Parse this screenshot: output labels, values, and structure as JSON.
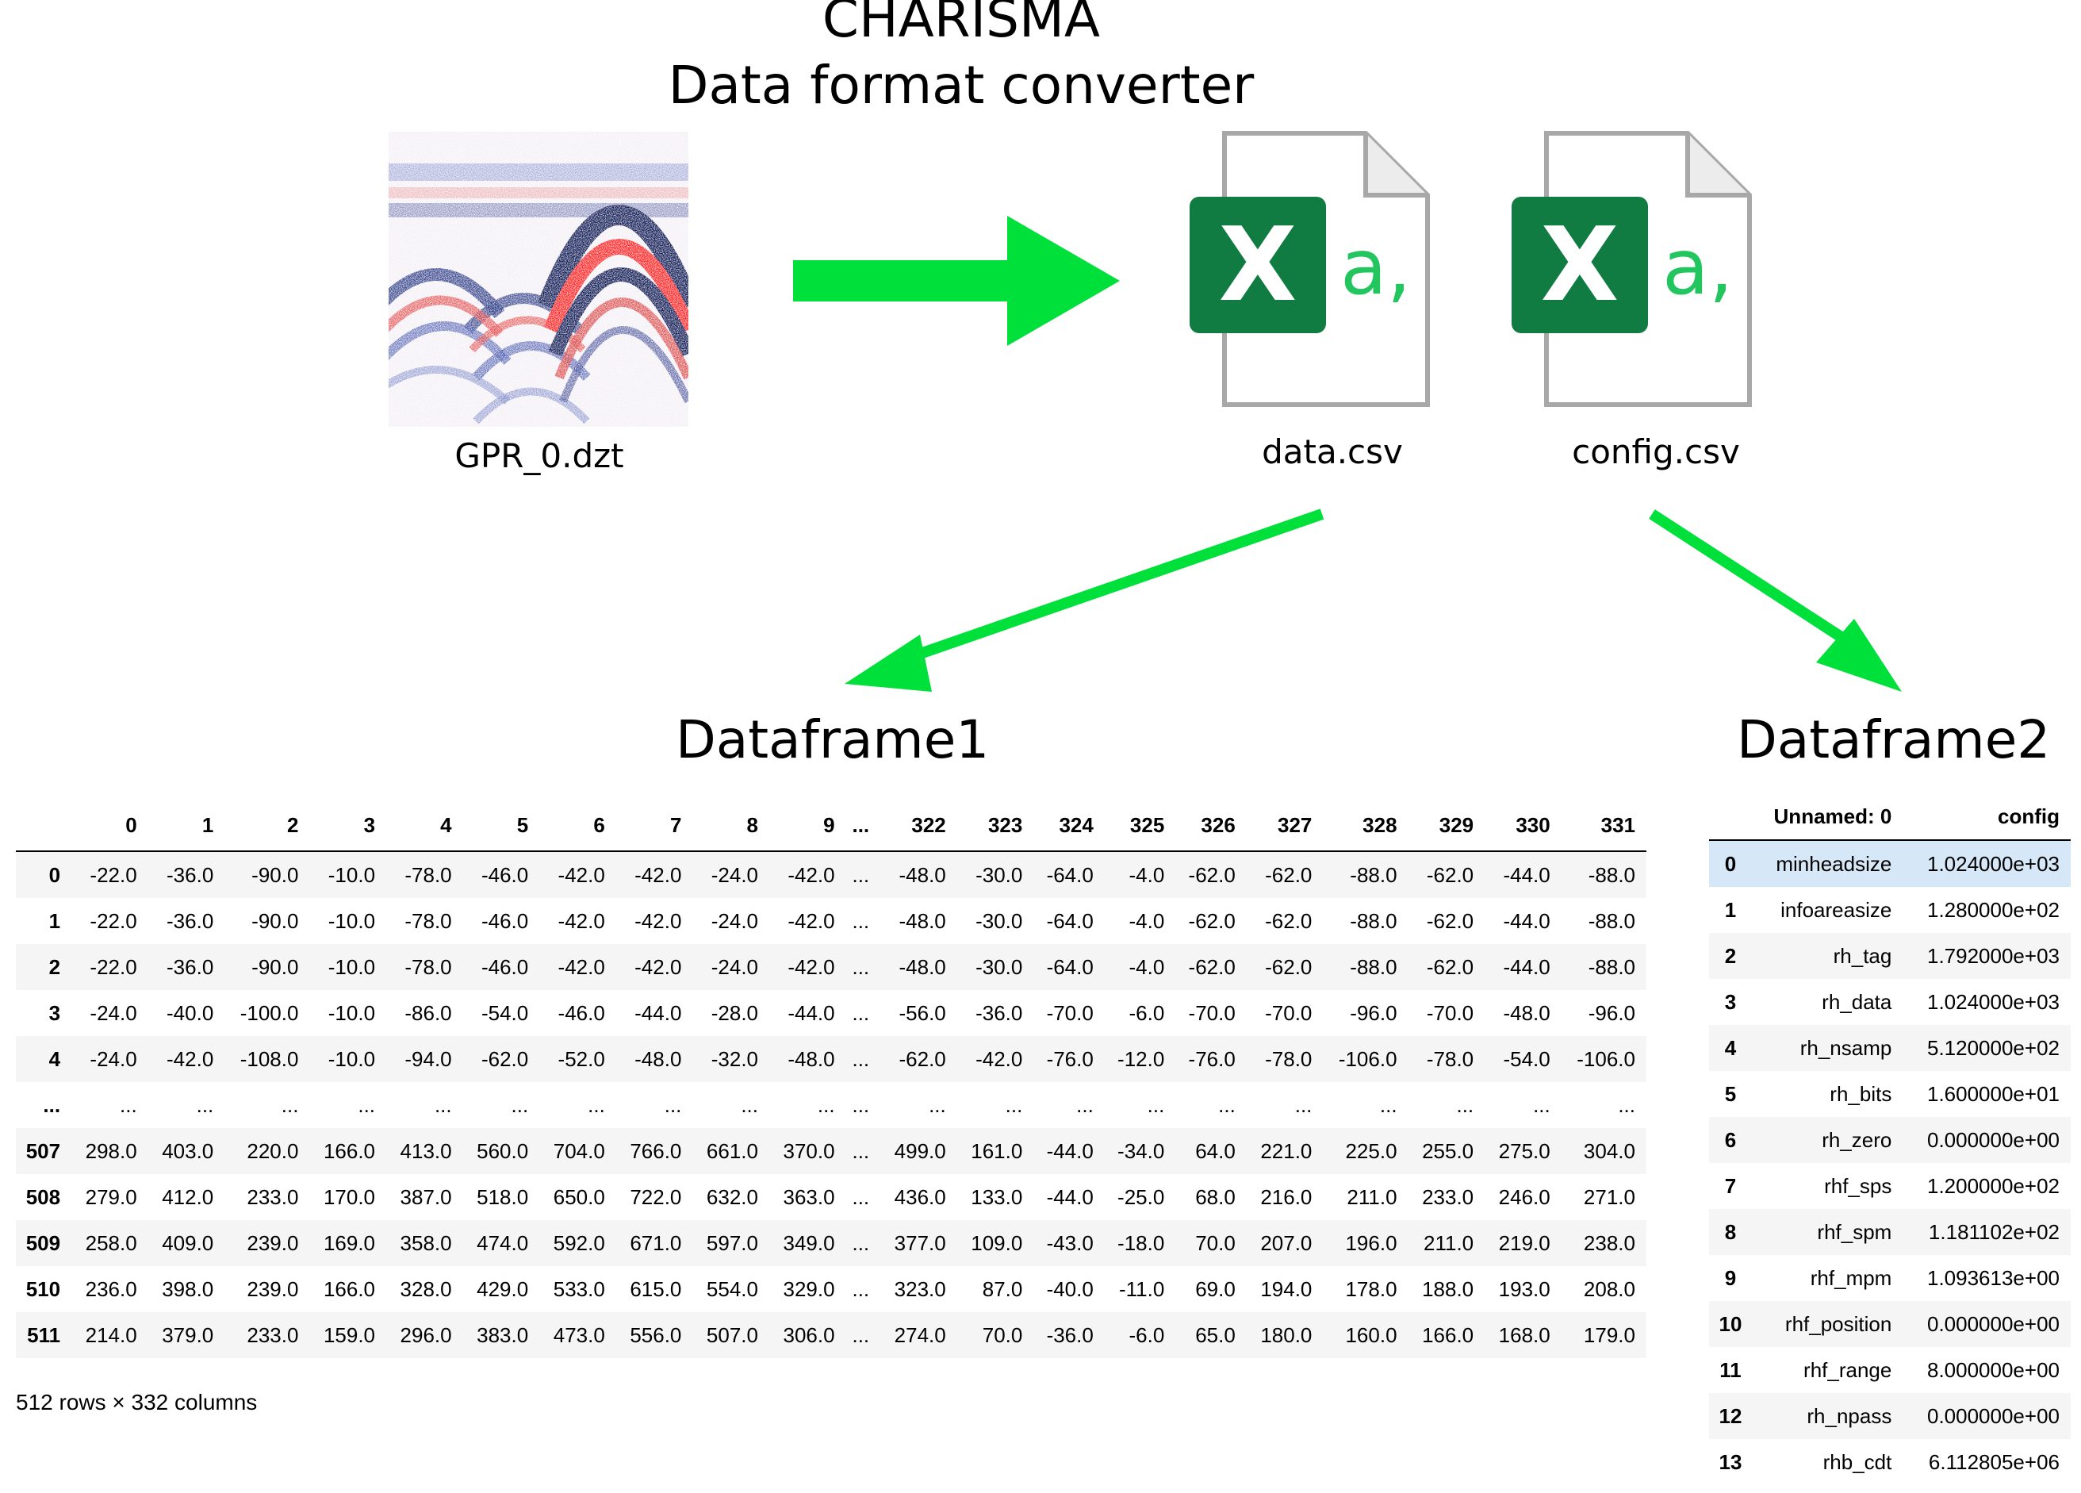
{
  "title": {
    "line1": "CHARISMA",
    "line2": "Data format converter"
  },
  "files": {
    "gpr": "GPR_0.dzt",
    "data": "data.csv",
    "config": "config.csv"
  },
  "icon_text": {
    "x": "X",
    "a": "a,"
  },
  "colors": {
    "arrow": "#00e03a",
    "excel_green": "#107c41",
    "light_green": "#22c55e"
  },
  "dataframe1": {
    "title": "Dataframe1",
    "columns": [
      "",
      "0",
      "1",
      "2",
      "3",
      "4",
      "5",
      "6",
      "7",
      "8",
      "9",
      "...",
      "322",
      "323",
      "324",
      "325",
      "326",
      "327",
      "328",
      "329",
      "330",
      "331"
    ],
    "rows": [
      [
        "0",
        "-22.0",
        "-36.0",
        "-90.0",
        "-10.0",
        "-78.0",
        "-46.0",
        "-42.0",
        "-42.0",
        "-24.0",
        "-42.0",
        "...",
        "-48.0",
        "-30.0",
        "-64.0",
        "-4.0",
        "-62.0",
        "-62.0",
        "-88.0",
        "-62.0",
        "-44.0",
        "-88.0"
      ],
      [
        "1",
        "-22.0",
        "-36.0",
        "-90.0",
        "-10.0",
        "-78.0",
        "-46.0",
        "-42.0",
        "-42.0",
        "-24.0",
        "-42.0",
        "...",
        "-48.0",
        "-30.0",
        "-64.0",
        "-4.0",
        "-62.0",
        "-62.0",
        "-88.0",
        "-62.0",
        "-44.0",
        "-88.0"
      ],
      [
        "2",
        "-22.0",
        "-36.0",
        "-90.0",
        "-10.0",
        "-78.0",
        "-46.0",
        "-42.0",
        "-42.0",
        "-24.0",
        "-42.0",
        "...",
        "-48.0",
        "-30.0",
        "-64.0",
        "-4.0",
        "-62.0",
        "-62.0",
        "-88.0",
        "-62.0",
        "-44.0",
        "-88.0"
      ],
      [
        "3",
        "-24.0",
        "-40.0",
        "-100.0",
        "-10.0",
        "-86.0",
        "-54.0",
        "-46.0",
        "-44.0",
        "-28.0",
        "-44.0",
        "...",
        "-56.0",
        "-36.0",
        "-70.0",
        "-6.0",
        "-70.0",
        "-70.0",
        "-96.0",
        "-70.0",
        "-48.0",
        "-96.0"
      ],
      [
        "4",
        "-24.0",
        "-42.0",
        "-108.0",
        "-10.0",
        "-94.0",
        "-62.0",
        "-52.0",
        "-48.0",
        "-32.0",
        "-48.0",
        "...",
        "-62.0",
        "-42.0",
        "-76.0",
        "-12.0",
        "-76.0",
        "-78.0",
        "-106.0",
        "-78.0",
        "-54.0",
        "-106.0"
      ],
      [
        "...",
        "...",
        "...",
        "...",
        "...",
        "...",
        "...",
        "...",
        "...",
        "...",
        "...",
        "...",
        "...",
        "...",
        "...",
        "...",
        "...",
        "...",
        "...",
        "...",
        "...",
        "..."
      ],
      [
        "507",
        "298.0",
        "403.0",
        "220.0",
        "166.0",
        "413.0",
        "560.0",
        "704.0",
        "766.0",
        "661.0",
        "370.0",
        "...",
        "499.0",
        "161.0",
        "-44.0",
        "-34.0",
        "64.0",
        "221.0",
        "225.0",
        "255.0",
        "275.0",
        "304.0"
      ],
      [
        "508",
        "279.0",
        "412.0",
        "233.0",
        "170.0",
        "387.0",
        "518.0",
        "650.0",
        "722.0",
        "632.0",
        "363.0",
        "...",
        "436.0",
        "133.0",
        "-44.0",
        "-25.0",
        "68.0",
        "216.0",
        "211.0",
        "233.0",
        "246.0",
        "271.0"
      ],
      [
        "509",
        "258.0",
        "409.0",
        "239.0",
        "169.0",
        "358.0",
        "474.0",
        "592.0",
        "671.0",
        "597.0",
        "349.0",
        "...",
        "377.0",
        "109.0",
        "-43.0",
        "-18.0",
        "70.0",
        "207.0",
        "196.0",
        "211.0",
        "219.0",
        "238.0"
      ],
      [
        "510",
        "236.0",
        "398.0",
        "239.0",
        "166.0",
        "328.0",
        "429.0",
        "533.0",
        "615.0",
        "554.0",
        "329.0",
        "...",
        "323.0",
        "87.0",
        "-40.0",
        "-11.0",
        "69.0",
        "194.0",
        "178.0",
        "188.0",
        "193.0",
        "208.0"
      ],
      [
        "511",
        "214.0",
        "379.0",
        "233.0",
        "159.0",
        "296.0",
        "383.0",
        "473.0",
        "556.0",
        "507.0",
        "306.0",
        "...",
        "274.0",
        "70.0",
        "-36.0",
        "-6.0",
        "65.0",
        "180.0",
        "160.0",
        "166.0",
        "168.0",
        "179.0"
      ]
    ],
    "shape": "512 rows × 332 columns"
  },
  "dataframe2": {
    "title": "Dataframe2",
    "columns": [
      "",
      "Unnamed: 0",
      "config"
    ],
    "rows": [
      [
        "0",
        "minheadsize",
        "1.024000e+03"
      ],
      [
        "1",
        "infoareasize",
        "1.280000e+02"
      ],
      [
        "2",
        "rh_tag",
        "1.792000e+03"
      ],
      [
        "3",
        "rh_data",
        "1.024000e+03"
      ],
      [
        "4",
        "rh_nsamp",
        "5.120000e+02"
      ],
      [
        "5",
        "rh_bits",
        "1.600000e+01"
      ],
      [
        "6",
        "rh_zero",
        "0.000000e+00"
      ],
      [
        "7",
        "rhf_sps",
        "1.200000e+02"
      ],
      [
        "8",
        "rhf_spm",
        "1.181102e+02"
      ],
      [
        "9",
        "rhf_mpm",
        "1.093613e+00"
      ],
      [
        "10",
        "rhf_position",
        "0.000000e+00"
      ],
      [
        "11",
        "rhf_range",
        "8.000000e+00"
      ],
      [
        "12",
        "rh_npass",
        "0.000000e+00"
      ],
      [
        "13",
        "rhb_cdt",
        "6.112805e+06"
      ]
    ],
    "selected_row": 0
  }
}
